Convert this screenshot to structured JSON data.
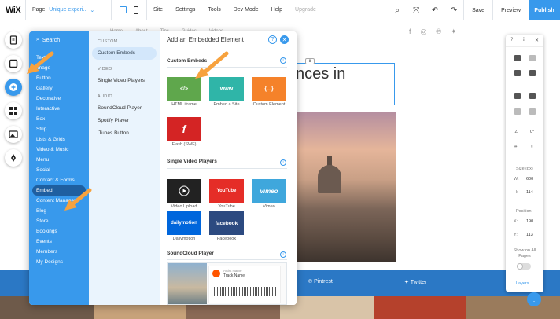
{
  "topbar": {
    "logo": "WiX",
    "page_label": "Page:",
    "page_name": "Unique experi...",
    "menu": [
      "Site",
      "Settings",
      "Tools",
      "Dev Mode",
      "Help",
      "Upgrade"
    ],
    "save": "Save",
    "preview": "Preview",
    "publish": "Publish"
  },
  "site": {
    "nav": [
      "Home",
      "About",
      "Tips",
      "Guides",
      "Videos"
    ],
    "hero_text": "nces in",
    "footer_links": [
      "Pintrest",
      "Twitter"
    ]
  },
  "add_panel": {
    "search": "Search",
    "categories": [
      "Text",
      "Image",
      "Button",
      "Gallery",
      "Decorative",
      "Interactive",
      "Box",
      "Strip",
      "Lists & Grids",
      "Video & Music",
      "Menu",
      "Social",
      "Contact & Forms",
      "Embed",
      "Content Manager",
      "Blog",
      "Store",
      "Bookings",
      "Events",
      "Members",
      "My Designs"
    ],
    "selected_category": "Embed",
    "sub": {
      "custom_header": "CUSTOM",
      "custom_items": [
        "Custom Embeds"
      ],
      "video_header": "VIDEO",
      "video_items": [
        "Single Video Players"
      ],
      "audio_header": "AUDIO",
      "audio_items": [
        "SoundCloud Player",
        "Spotify Player",
        "iTunes Button"
      ]
    },
    "title": "Add an Embedded Element",
    "sections": {
      "custom": "Custom Embeds",
      "video": "Single Video Players",
      "soundcloud": "SoundCloud Player"
    },
    "custom_tiles": [
      "HTML iframe",
      "Embed a Site",
      "Custom Element",
      "Flash (SWF)"
    ],
    "video_tiles": [
      "Video Upload",
      "YouTube",
      "Vimeo",
      "Dailymotion",
      "Facebook"
    ],
    "tile_badges": {
      "html": "</>",
      "site": "www",
      "custom": "{...}",
      "youtube": "YouTube",
      "vimeo": "vimeo",
      "dailymotion": "dailymotion",
      "facebook": "facebook"
    },
    "soundcloud_artist": "Artist Name",
    "soundcloud_track": "Track Name"
  },
  "right_panel": {
    "help": "?",
    "size_label": "Size (px)",
    "w_label": "W:",
    "w_value": "600",
    "h_label": "H:",
    "h_value": "114",
    "position_label": "Position",
    "x_label": "X:",
    "x_value": "190",
    "y_label": "Y:",
    "y_value": "113",
    "angle_value": "0°",
    "show_all_pages": "Show on All Pages",
    "layers": "Layers"
  }
}
